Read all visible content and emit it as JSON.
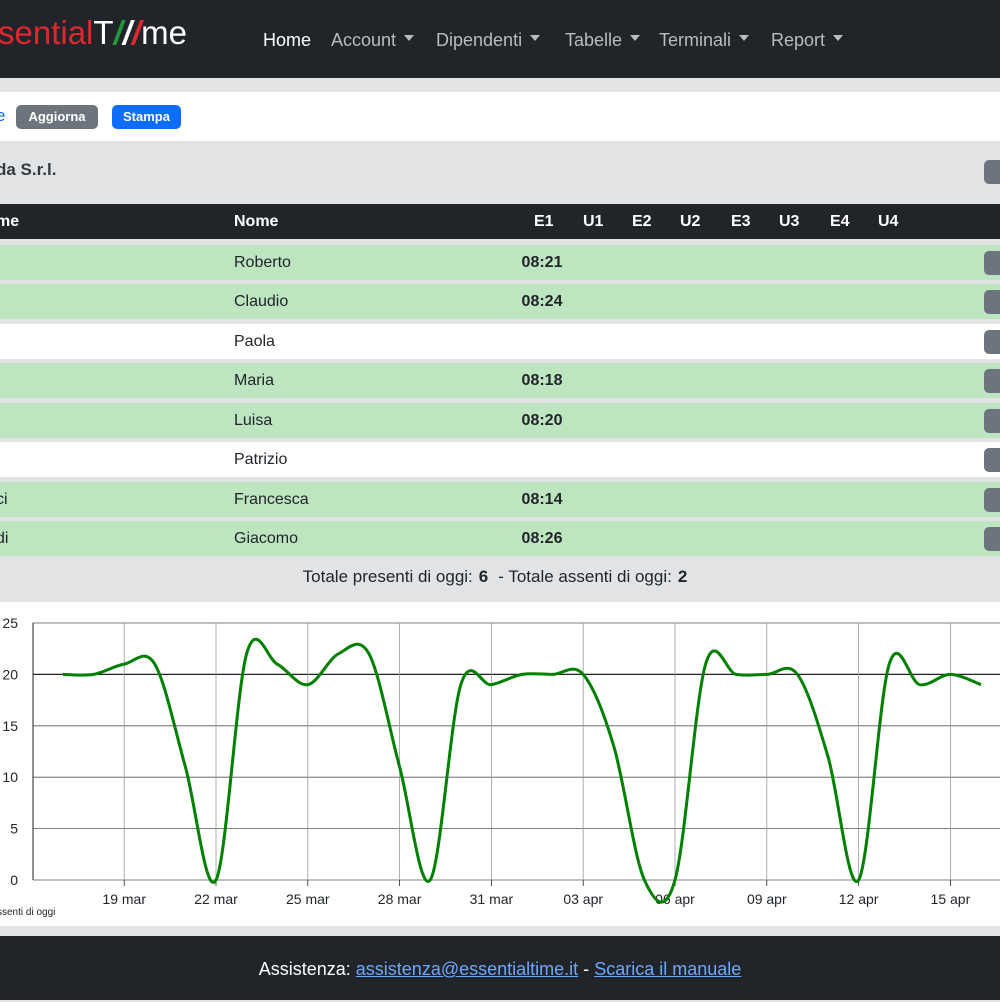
{
  "brand": {
    "part1": "sential",
    "part2": "T",
    "part3": "me"
  },
  "nav": [
    {
      "label": "Home",
      "active": true,
      "dropdown": false
    },
    {
      "label": "Account",
      "dropdown": true
    },
    {
      "label": "Dipendenti",
      "dropdown": true
    },
    {
      "label": "Tabelle",
      "dropdown": true
    },
    {
      "label": "Terminali",
      "dropdown": true
    },
    {
      "label": "Report",
      "dropdown": true
    }
  ],
  "toolbar": {
    "edge_text": "e",
    "refresh_label": "Aggiorna",
    "print_label": "Stampa"
  },
  "company": {
    "name": "da S.r.l."
  },
  "table": {
    "headers": {
      "cognome": "me",
      "nome": "Nome",
      "e1": "E1",
      "u1": "U1",
      "e2": "E2",
      "u2": "U2",
      "e3": "E3",
      "u3": "U3",
      "e4": "E4",
      "u4": "U4"
    },
    "rows": [
      {
        "cognome": "",
        "nome": "Roberto",
        "e1": "08:21",
        "present": true
      },
      {
        "cognome": "",
        "nome": "Claudio",
        "e1": "08:24",
        "present": true
      },
      {
        "cognome": "",
        "nome": "Paola",
        "e1": "",
        "present": false
      },
      {
        "cognome": "",
        "nome": "Maria",
        "e1": "08:18",
        "present": true
      },
      {
        "cognome": "",
        "nome": "Luisa",
        "e1": "08:20",
        "present": true
      },
      {
        "cognome": "",
        "nome": "Patrizio",
        "e1": "",
        "present": false
      },
      {
        "cognome": "ci",
        "nome": "Francesca",
        "e1": "08:14",
        "present": true
      },
      {
        "cognome": "di",
        "nome": "Giacomo",
        "e1": "08:26",
        "present": true
      }
    ]
  },
  "totals": {
    "present_label": "Totale presenti di oggi:",
    "present_value": "6",
    "separator": "-",
    "absent_label": "Totale assenti di oggi:",
    "absent_value": "2"
  },
  "chart_data": {
    "type": "line",
    "x": [
      "17 mar",
      "18 mar",
      "19 mar",
      "20 mar",
      "21 mar",
      "22 mar",
      "23 mar",
      "24 mar",
      "25 mar",
      "26 mar",
      "27 mar",
      "28 mar",
      "29 mar",
      "30 mar",
      "31 mar",
      "01 apr",
      "02 apr",
      "03 apr",
      "04 apr",
      "05 apr",
      "06 apr",
      "07 apr",
      "08 apr",
      "09 apr",
      "10 apr",
      "11 apr",
      "12 apr",
      "13 apr",
      "14 apr",
      "15 apr",
      "16 apr"
    ],
    "series": [
      {
        "name": "",
        "color": "#008000",
        "values": [
          20,
          20,
          21,
          21,
          11,
          0,
          22,
          21,
          19,
          22,
          22,
          11,
          0,
          19,
          19,
          20,
          20,
          20,
          13,
          0,
          0,
          21,
          20,
          20,
          20,
          12,
          0,
          21,
          19,
          20,
          19
        ]
      }
    ],
    "tick_labels": [
      "19 mar",
      "22 mar",
      "25 mar",
      "28 mar",
      "31 mar",
      "03 apr",
      "06 apr",
      "09 apr",
      "12 apr",
      "15 apr"
    ],
    "y_ticks": [
      "0",
      "5",
      "10",
      "15",
      "20",
      "25"
    ],
    "ylim": [
      0,
      25
    ],
    "grid": true,
    "legend_text": "ssenti di oggi"
  },
  "footer": {
    "label": "Assistenza:",
    "email": "assistenza@essentialtime.it",
    "separator": "-",
    "manual_label": "Scarica il manuale"
  }
}
